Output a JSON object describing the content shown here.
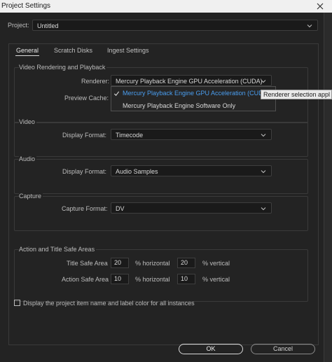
{
  "window": {
    "title": "Project Settings"
  },
  "project": {
    "label": "Project:",
    "value": "Untitled"
  },
  "tabs": [
    {
      "label": "General"
    },
    {
      "label": "Scratch Disks"
    },
    {
      "label": "Ingest Settings"
    }
  ],
  "video_rendering": {
    "title": "Video Rendering and Playback",
    "renderer_label": "Renderer:",
    "renderer_value": "Mercury Playback Engine GPU Acceleration (CUDA)",
    "preview_cache_label": "Preview Cache:",
    "dropdown_options": [
      "Mercury Playback Engine GPU Acceleration (CUDA)",
      "Mercury Playback Engine Software Only"
    ],
    "tooltip": "Renderer selection appl"
  },
  "video": {
    "title": "Video",
    "display_format_label": "Display Format:",
    "display_format_value": "Timecode"
  },
  "audio": {
    "title": "Audio",
    "display_format_label": "Display Format:",
    "display_format_value": "Audio Samples"
  },
  "capture": {
    "title": "Capture",
    "capture_format_label": "Capture Format:",
    "capture_format_value": "DV"
  },
  "safe_areas": {
    "title": "Action and Title Safe Areas",
    "title_safe_label": "Title Safe Area",
    "title_safe_h": "20",
    "title_safe_v": "20",
    "action_safe_label": "Action Safe Area",
    "action_safe_h": "10",
    "action_safe_v": "10",
    "horizontal_label": "% horizontal",
    "vertical_label": "% vertical"
  },
  "display_label_checkbox": {
    "label": "Display the project item name and label color for all instances",
    "checked": false
  },
  "buttons": {
    "ok": "OK",
    "cancel": "Cancel"
  },
  "colors": {
    "accent": "#4a9ef0",
    "background": "#232323"
  }
}
